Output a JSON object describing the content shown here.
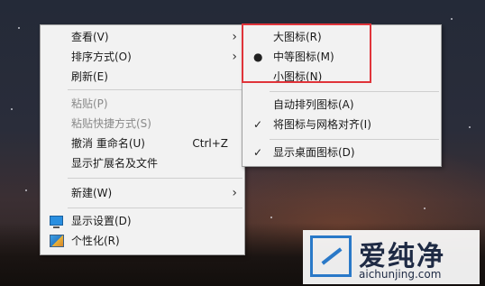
{
  "context_menu": {
    "items": [
      {
        "label": "查看(V)",
        "has_submenu": true,
        "disabled": false
      },
      {
        "label": "排序方式(O)",
        "has_submenu": true,
        "disabled": false
      },
      {
        "label": "刷新(E)",
        "has_submenu": false,
        "disabled": false
      },
      {
        "label": "粘贴(P)",
        "has_submenu": false,
        "disabled": true
      },
      {
        "label": "粘贴快捷方式(S)",
        "has_submenu": false,
        "disabled": true
      },
      {
        "label": "撤消 重命名(U)",
        "shortcut": "Ctrl+Z",
        "has_submenu": false,
        "disabled": false
      },
      {
        "label": "显示扩展名及文件",
        "has_submenu": false,
        "disabled": false
      },
      {
        "label": "新建(W)",
        "has_submenu": true,
        "disabled": false
      },
      {
        "label": "显示设置(D)",
        "icon": "display-settings-icon",
        "has_submenu": false,
        "disabled": false
      },
      {
        "label": "个性化(R)",
        "icon": "personalize-icon",
        "has_submenu": false,
        "disabled": false
      }
    ]
  },
  "view_submenu": {
    "items": [
      {
        "label": "大图标(R)",
        "selected": false
      },
      {
        "label": "中等图标(M)",
        "selected": true
      },
      {
        "label": "小图标(N)",
        "selected": false
      },
      {
        "label": "自动排列图标(A)",
        "checked": false
      },
      {
        "label": "将图标与网格对齐(I)",
        "checked": true
      },
      {
        "label": "显示桌面图标(D)",
        "checked": true
      }
    ]
  },
  "colors": {
    "menu_background": "#f2f2f2",
    "highlight_box": "#e0343a",
    "disabled_text": "#8a8a8a",
    "watermark_blue": "#2a79c8"
  },
  "watermark": {
    "name": "爱纯净",
    "url": "aichunjing.com"
  }
}
